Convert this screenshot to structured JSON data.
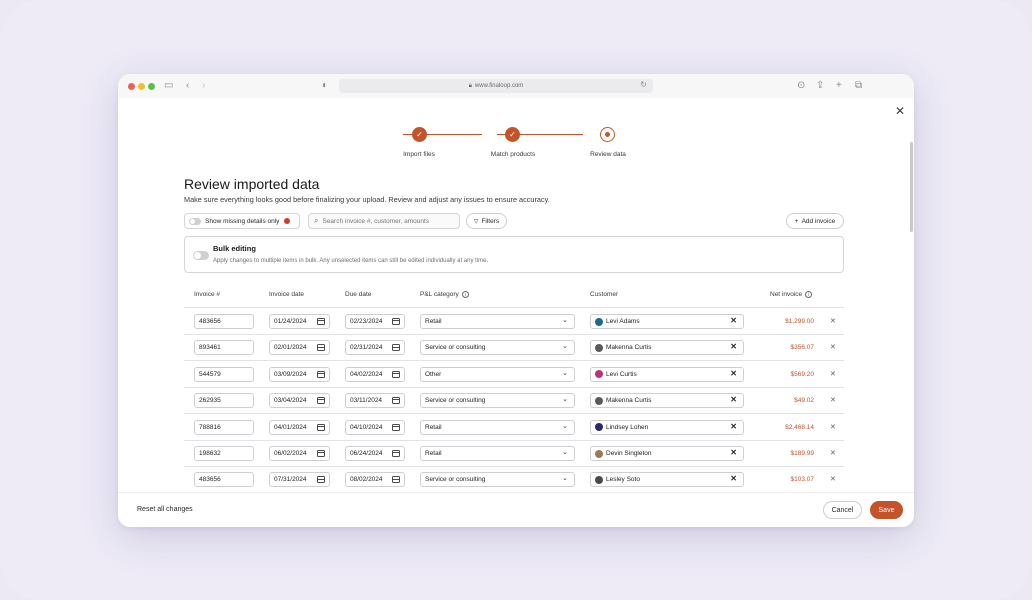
{
  "browser": {
    "url": "www.finaloop.com"
  },
  "stepper": {
    "steps": [
      {
        "label": "Import files",
        "state": "done"
      },
      {
        "label": "Match products",
        "state": "done"
      },
      {
        "label": "Review data",
        "state": "current"
      }
    ]
  },
  "page": {
    "title": "Review imported data",
    "subtitle": "Make sure everything looks good before finalizing your upload. Review and adjust any issues to ensure accuracy."
  },
  "toolbar": {
    "missing_toggle_label": "Show missing details only",
    "search_placeholder": "Search invoice #, customer, amounts",
    "filters_label": "Filters",
    "add_invoice_label": "Add invoice"
  },
  "bulk": {
    "title": "Bulk editing",
    "description": "Apply changes to multiple items in bulk. Any unselected items can still be edited individually at any time."
  },
  "table": {
    "headers": {
      "invoice": "Invoice #",
      "invoice_date": "Invoice date",
      "due_date": "Due date",
      "category": "P&L category",
      "customer": "Customer",
      "net": "Net invoice"
    },
    "rows": [
      {
        "invoice": "483656",
        "invoice_date": "01/24/2024",
        "due_date": "02/23/2024",
        "category": "Retail",
        "customer": "Levi Adams",
        "avatar_color": "#1b6a8a",
        "net": "$1,299.00"
      },
      {
        "invoice": "893461",
        "invoice_date": "02/01/2024",
        "due_date": "02/31/2024",
        "category": "Service or consulting",
        "customer": "Makenna Curtis",
        "avatar_color": "#5a5a5a",
        "net": "$356.07"
      },
      {
        "invoice": "544579",
        "invoice_date": "03/09/2024",
        "due_date": "04/02/2024",
        "category": "Other",
        "customer": "Levi Curtis",
        "avatar_color": "#c0307a",
        "net": "$569.20"
      },
      {
        "invoice": "262935",
        "invoice_date": "03/04/2024",
        "due_date": "03/11/2024",
        "category": "Service or consulting",
        "customer": "Makenna Curtis",
        "avatar_color": "#5a5a5a",
        "net": "$49.02"
      },
      {
        "invoice": "788816",
        "invoice_date": "04/01/2024",
        "due_date": "04/10/2024",
        "category": "Retail",
        "customer": "Lindsey Lohen",
        "avatar_color": "#2a2a6a",
        "net": "$2,468.14"
      },
      {
        "invoice": "198632",
        "invoice_date": "06/02/2024",
        "due_date": "06/24/2024",
        "category": "Retail",
        "customer": "Devin Singleton",
        "avatar_color": "#9a7a50",
        "net": "$189.99"
      },
      {
        "invoice": "483656",
        "invoice_date": "07/31/2024",
        "due_date": "08/02/2024",
        "category": "Service or consulting",
        "customer": "Lesley Soto",
        "avatar_color": "#4a4a4a",
        "net": "$103.07"
      }
    ]
  },
  "footer": {
    "reset_label": "Reset all changes",
    "cancel_label": "Cancel",
    "save_label": "Save"
  },
  "colors": {
    "accent": "#c4532a"
  }
}
